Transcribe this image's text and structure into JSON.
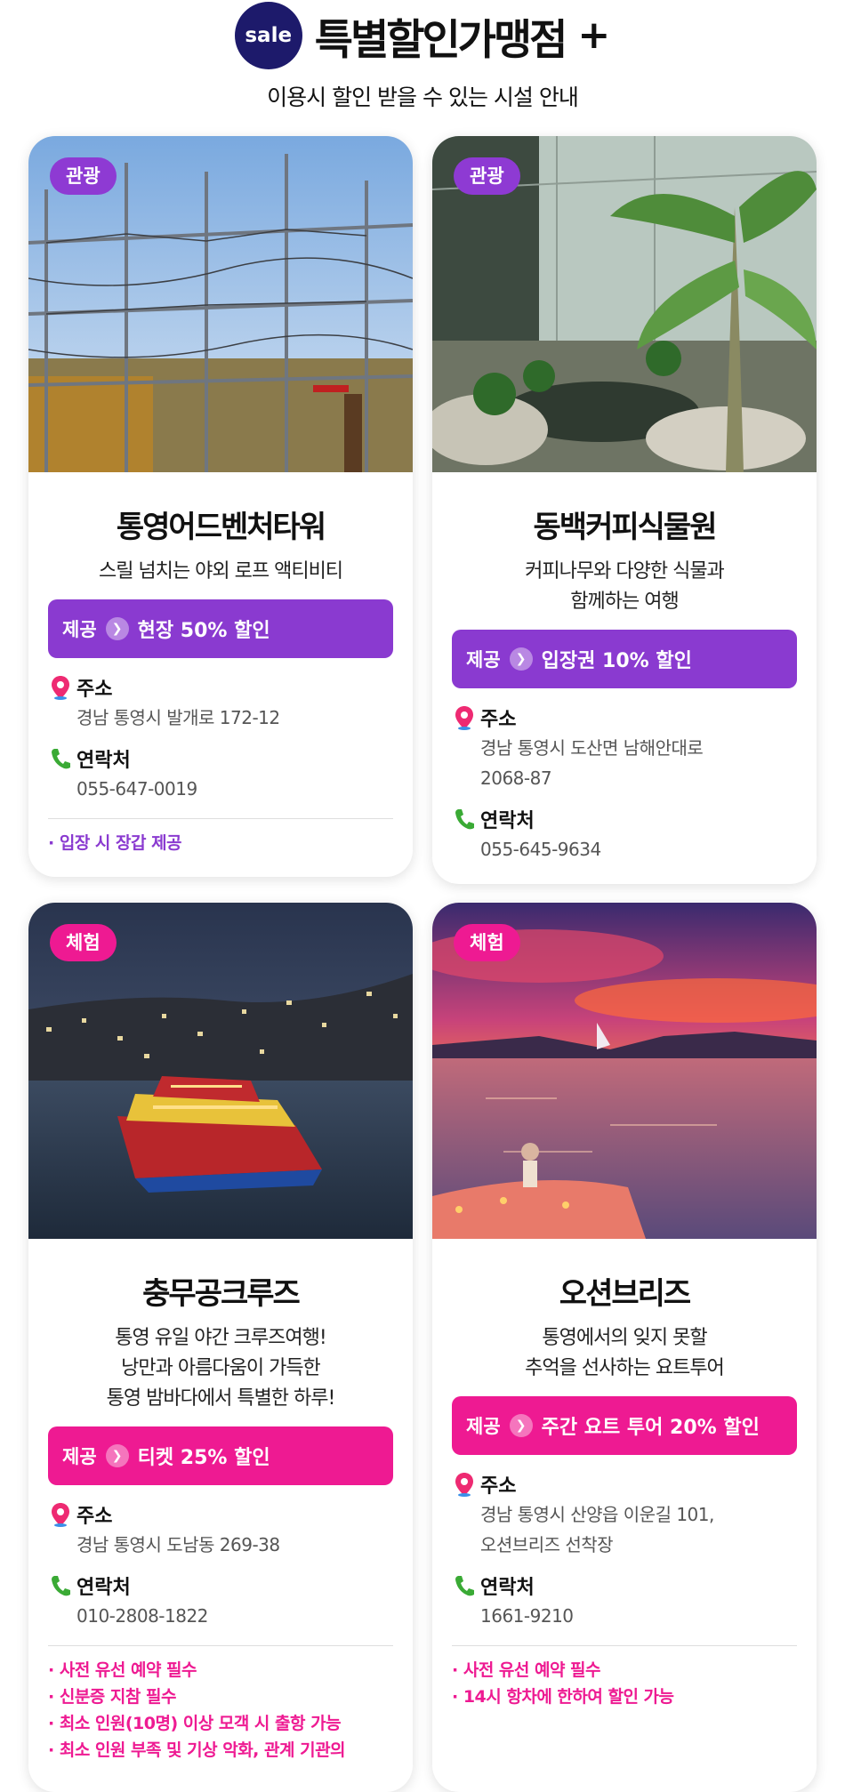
{
  "header": {
    "badge": "sale",
    "title": "특별할인가맹점",
    "subtitle": "이용시 할인 받을 수 있는 시설 안내"
  },
  "cards": [
    {
      "category": "관광",
      "name": "통영어드벤처타워",
      "desc": [
        "스릴 넘치는 야외 로프 액티비티"
      ],
      "benefit_label": "제공",
      "benefit": "현장 50% 할인",
      "address_label": "주소",
      "address": [
        "경남 통영시 발개로 172-12"
      ],
      "contact_label": "연락처",
      "contact": "055-647-0019",
      "notes": [
        "· 입장 시 장갑 제공"
      ]
    },
    {
      "category": "관광",
      "name": "동백커피식물원",
      "desc": [
        "커피나무와 다양한 식물과",
        "함께하는 여행"
      ],
      "benefit_label": "제공",
      "benefit": "입장권 10% 할인",
      "address_label": "주소",
      "address": [
        "경남 통영시 도산면 남해안대로",
        "2068-87"
      ],
      "contact_label": "연락처",
      "contact": "055-645-9634",
      "notes": []
    },
    {
      "category": "체험",
      "name": "충무공크루즈",
      "desc": [
        "통영 유일 야간 크루즈여행!",
        "낭만과 아름다움이 가득한",
        "통영 밤바다에서 특별한 하루!"
      ],
      "benefit_label": "제공",
      "benefit": "티켓 25% 할인",
      "address_label": "주소",
      "address": [
        "경남 통영시 도남동 269-38"
      ],
      "contact_label": "연락처",
      "contact": "010-2808-1822",
      "notes": [
        "· 사전 유선 예약 필수",
        "· 신분증 지참 필수",
        "· 최소 인원(10명) 이상 모객 시 출항 가능",
        "· 최소 인원 부족 및 기상 악화, 관계 기관의"
      ]
    },
    {
      "category": "체험",
      "name": "오션브리즈",
      "desc": [
        "통영에서의 잊지 못할",
        "추억을 선사하는 요트투어"
      ],
      "benefit_label": "제공",
      "benefit": "주간 요트 투어 20% 할인",
      "address_label": "주소",
      "address": [
        "경남 통영시 산양읍 이운길 101,",
        "오션브리즈 선착장"
      ],
      "contact_label": "연락처",
      "contact": "1661-9210",
      "notes": [
        "· 사전 유선 예약 필수",
        "· 14시 항차에 한하여 할인 가능"
      ]
    }
  ],
  "colors": {
    "purple": "#8a3ad0",
    "pink": "#ee1a92",
    "navy": "#1d1a6b"
  },
  "icons": [
    "plus-icon",
    "chevron-right-icon",
    "location-pin-icon",
    "phone-icon"
  ]
}
